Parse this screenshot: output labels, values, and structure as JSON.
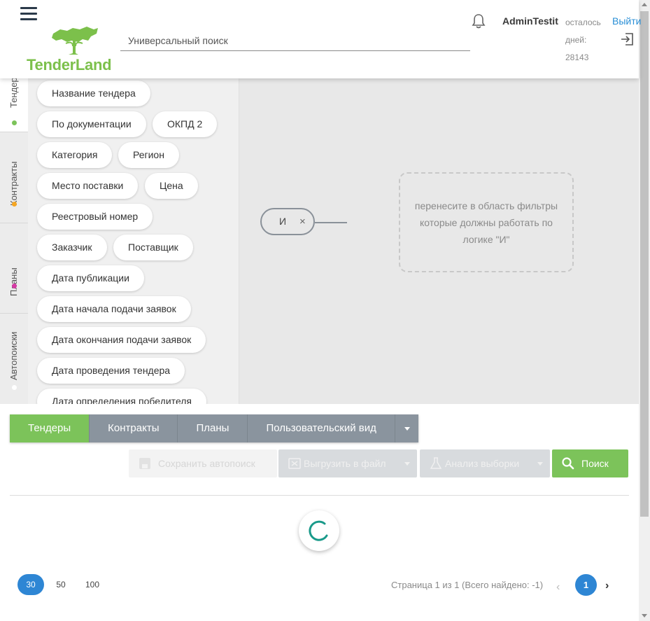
{
  "header": {
    "logo_text": "TenderLand",
    "search_placeholder": "Универсальный поиск",
    "user_name": "AdminTestit",
    "days_label": "осталось дней:",
    "days_value": "28143",
    "logout_label": "Выйти"
  },
  "vtabs": [
    {
      "label": "Тендеры",
      "dot_color": "#7cc35a"
    },
    {
      "label": "Контракты",
      "dot_color": "#f5a623"
    },
    {
      "label": "Планы",
      "dot_color": "#d63aa5"
    },
    {
      "label": "Автопоиски",
      "dot_color": "#ffffff"
    }
  ],
  "filters": [
    "Название тендера",
    "По документации",
    "ОКПД 2",
    "Категория",
    "Регион",
    "Место поставки",
    "Цена",
    "Реестровый номер",
    "Заказчик",
    "Поставщик",
    "Дата публикации",
    "Дата начала подачи заявок",
    "Дата окончания подачи заявок",
    "Дата проведения тендера",
    "Дата определения победителя"
  ],
  "logic": {
    "operator_label": "И",
    "remove_symbol": "×",
    "dropzone_text": "перенесите в область фильтры которые должны работать по логике \"И\""
  },
  "view_tabs": {
    "items": [
      "Тендеры",
      "Контракты",
      "Планы",
      "Пользовательский вид"
    ],
    "active": "Тендеры"
  },
  "actions": {
    "save_autosearch": "Сохранить автопоиск",
    "export_file": "Выгрузить в файл",
    "analyze": "Анализ выборки",
    "search": "Поиск"
  },
  "pagination": {
    "page_sizes": [
      "30",
      "50",
      "100"
    ],
    "active_size": "30",
    "page_info": "Страница 1 из 1 (Всего найдено: -1)",
    "current_page": "1",
    "prev_symbol": "‹",
    "next_symbol": "›"
  },
  "colors": {
    "brand_green": "#7cc35a",
    "accent_blue": "#2e86d4",
    "spinner_teal": "#1a9a8a"
  }
}
